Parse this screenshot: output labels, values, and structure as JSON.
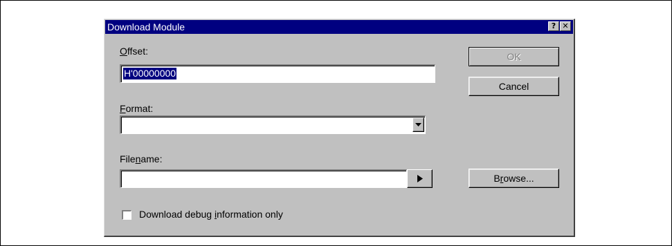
{
  "dialog": {
    "title": "Download Module",
    "help_glyph": "?",
    "close_glyph": "✕",
    "offset": {
      "label_pre": "",
      "label_accel": "O",
      "label_post": "ffset:",
      "value": "H'00000000"
    },
    "format": {
      "label_pre": "",
      "label_accel": "F",
      "label_post": "ormat:",
      "value": ""
    },
    "filename": {
      "label_pre": "File",
      "label_accel": "n",
      "label_post": "ame:",
      "value": ""
    },
    "checkbox": {
      "label_pre": "Download debug ",
      "label_accel": "i",
      "label_post": "nformation only",
      "checked": false
    },
    "buttons": {
      "ok": "OK",
      "cancel": "Cancel",
      "browse_pre": "B",
      "browse_accel": "r",
      "browse_post": "owse..."
    },
    "icons": {
      "help": "help-icon",
      "close": "close-icon",
      "dropdown": "chevron-down-icon",
      "arrow": "play-arrow-icon"
    }
  }
}
